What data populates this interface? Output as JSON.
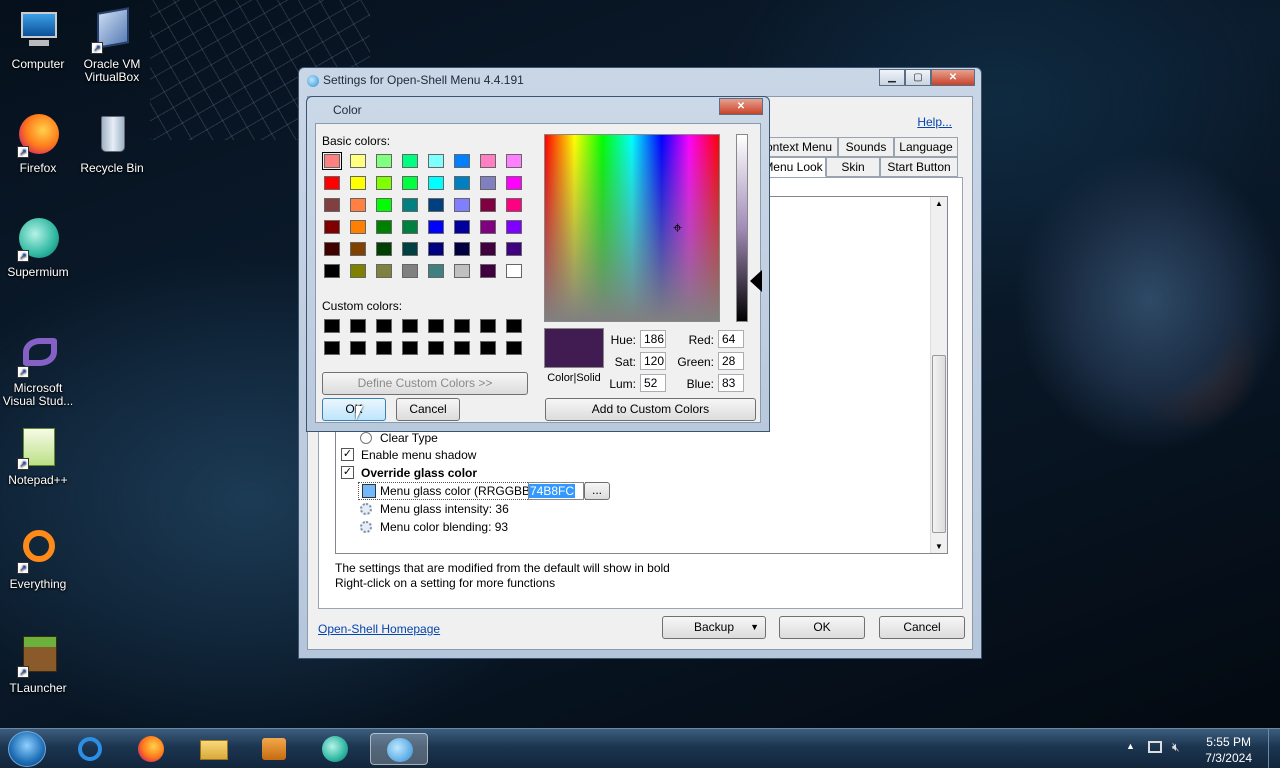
{
  "desktop": {
    "icons": [
      {
        "label": "Computer"
      },
      {
        "label": "Oracle VM VirtualBox"
      },
      {
        "label": "Firefox"
      },
      {
        "label": "Recycle Bin"
      },
      {
        "label": "Supermium"
      },
      {
        "label": "Microsoft Visual Stud..."
      },
      {
        "label": "Notepad++"
      },
      {
        "label": "Everything"
      },
      {
        "label": "TLauncher"
      }
    ]
  },
  "settings_window": {
    "title": "Settings for Open-Shell Menu 4.4.191",
    "help_link": "Help...",
    "tabs_row1": [
      "ontext Menu",
      "Sounds",
      "Language"
    ],
    "tabs_row2": [
      "Menu Look",
      "Skin",
      "Start Button"
    ],
    "tree_items": {
      "clear_type": "Clear Type",
      "enable_shadow": "Enable menu shadow",
      "override_glass": "Override glass color",
      "glass_color_label": "Menu glass color (RRGGBB)",
      "glass_color_value": "74B8FC",
      "browse": "...",
      "glass_intensity": "Menu glass intensity: 36",
      "color_blending": "Menu color blending: 93"
    },
    "info_line1": "The settings that are modified from the default will show in bold",
    "info_line2": "Right-click on a setting for more functions",
    "homepage_link": "Open-Shell Homepage",
    "buttons": {
      "backup": "Backup",
      "ok": "OK",
      "cancel": "Cancel"
    }
  },
  "color_dialog": {
    "title": "Color",
    "basic_colors_label": "Basic colors:",
    "custom_colors_label": "Custom colors:",
    "define_custom": "Define Custom Colors >>",
    "ok": "OK",
    "cancel": "Cancel",
    "add_custom": "Add to Custom Colors",
    "color_solid": "Color|Solid",
    "hue_label": "Hue:",
    "hue": "186",
    "sat_label": "Sat:",
    "sat": "120",
    "lum_label": "Lum:",
    "lum": "52",
    "red_label": "Red:",
    "red": "64",
    "green_label": "Green:",
    "green": "28",
    "blue_label": "Blue:",
    "blue": "83",
    "preview_color": "#401c53",
    "basic_colors": [
      "#ff8080",
      "#ffff80",
      "#80ff80",
      "#00ff80",
      "#80ffff",
      "#0080ff",
      "#ff80c0",
      "#ff80ff",
      "#ff0000",
      "#ffff00",
      "#80ff00",
      "#00ff40",
      "#00ffff",
      "#0080c0",
      "#8080c0",
      "#ff00ff",
      "#804040",
      "#ff8040",
      "#00ff00",
      "#008080",
      "#004080",
      "#8080ff",
      "#800040",
      "#ff0080",
      "#800000",
      "#ff8000",
      "#008000",
      "#008040",
      "#0000ff",
      "#0000a0",
      "#800080",
      "#8000ff",
      "#400000",
      "#804000",
      "#004000",
      "#004040",
      "#000080",
      "#000040",
      "#400040",
      "#400080",
      "#000000",
      "#808000",
      "#808040",
      "#808080",
      "#408080",
      "#c0c0c0",
      "#400040",
      "#ffffff"
    ]
  },
  "taskbar": {
    "time": "5:55 PM",
    "date": "7/3/2024"
  }
}
